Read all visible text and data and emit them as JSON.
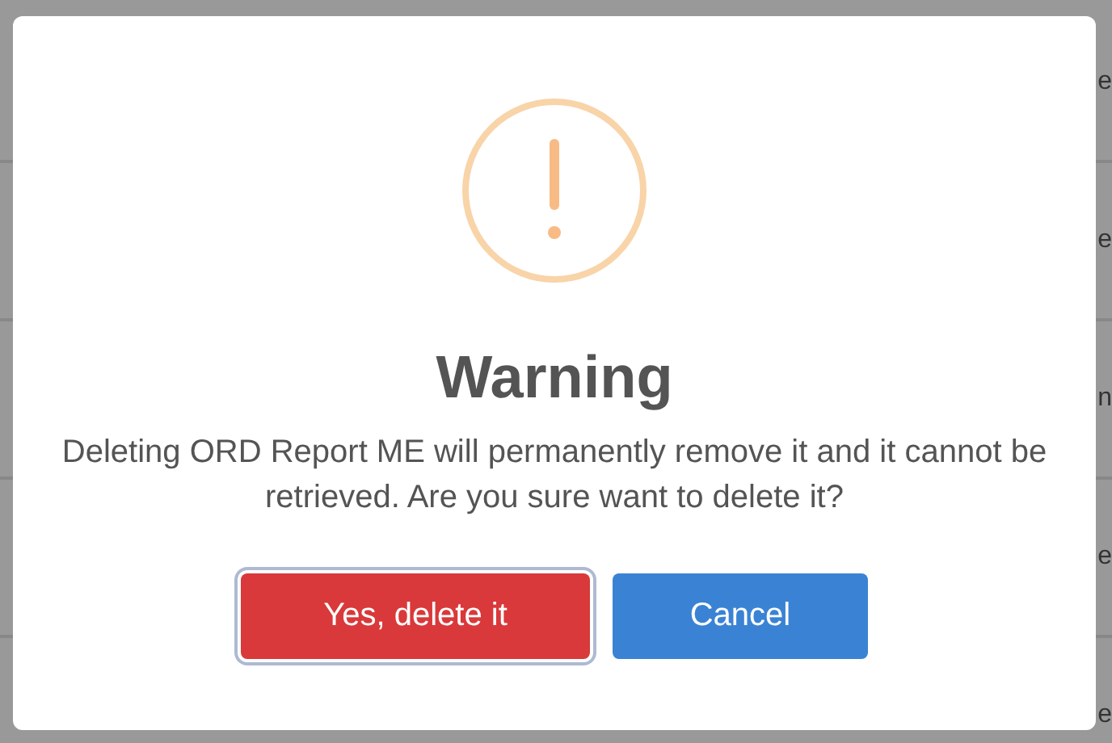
{
  "background_rows": [
    {
      "text": "e"
    },
    {
      "text": "e"
    },
    {
      "text": "n"
    },
    {
      "text": "e"
    },
    {
      "text": "e"
    }
  ],
  "dialog": {
    "title": "Warning",
    "message": "Deleting ORD Report ME will permanently remove it and it cannot be retrieved. Are you sure want to delete it?",
    "buttons": [
      {
        "label": "Yes, delete it",
        "kind": "confirm",
        "focused": true
      },
      {
        "label": "Cancel",
        "kind": "cancel",
        "focused": false
      }
    ]
  }
}
